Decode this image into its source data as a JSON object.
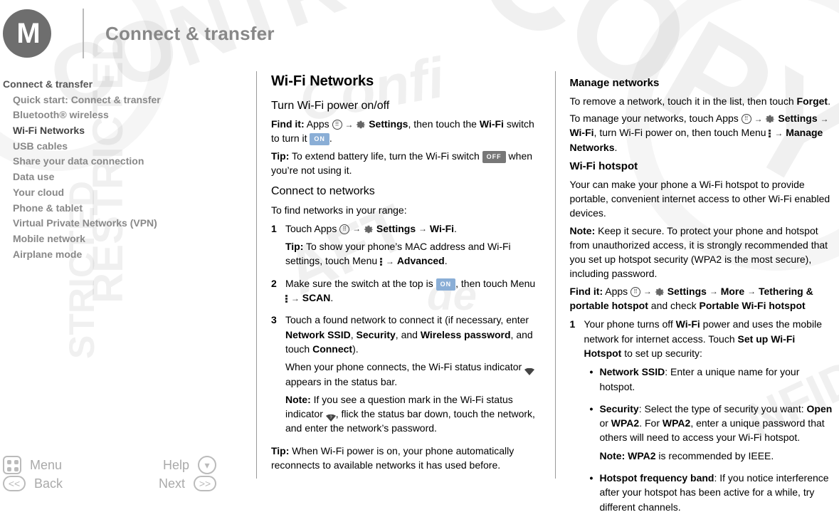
{
  "pageTitle": "Connect & transfer",
  "watermarks": {
    "w1": "CONTRO",
    "w2": "RESTRICTED",
    "w3": "COPY",
    "w4": "STRICTED",
    "w5": "Confi",
    "w6": "AFT",
    "w7": "de",
    "w8": "NFID"
  },
  "sidebar": {
    "root": "Connect & transfer",
    "items": [
      "Quick start: Connect & transfer",
      "Bluetooth® wireless",
      "Wi-Fi Networks",
      "USB cables",
      "Share your data connection",
      "Data use",
      "Your cloud",
      "Phone & tablet",
      "Virtual Private Networks (VPN)",
      "Mobile network",
      "Airplane mode"
    ],
    "nav": {
      "menu": "Menu",
      "help": "Help",
      "back": "Back",
      "next": "Next",
      "prev": "<<",
      "fwd": ">>"
    }
  },
  "switches": {
    "on": "ON",
    "off": "OFF"
  },
  "col1": {
    "h2": "Wi-Fi Networks",
    "sub1": "Turn Wi-Fi power on/off",
    "findIt1a": "Find it:",
    "findIt1b": "Apps",
    "findIt1c": "Settings",
    "findIt1d": ", then touch the ",
    "findIt1e": "Wi-Fi",
    "findIt1f": " switch to turn it ",
    "findIt1g": ".",
    "tip1a": "Tip:",
    "tip1b": " To extend battery life, turn the Wi-Fi switch ",
    "tip1c": " when you’re not using it.",
    "sub2": "Connect to networks",
    "p2": "To find networks in your range:",
    "li1a": "Touch Apps ",
    "li1b": "Settings",
    "li1c": "Wi-Fi",
    "li1d": ".",
    "li1tipA": "Tip:",
    "li1tipB": " To show your phone’s MAC address and Wi-Fi settings, touch Menu ",
    "li1tipC": "Advanced",
    "li1tipD": ".",
    "li2a": "Make sure the switch at the top is ",
    "li2b": ", then touch Menu ",
    "li2c": "SCAN",
    "li2d": ".",
    "li3a": "Touch a found network to connect it (if necessary, enter ",
    "li3b": "Network SSID",
    "li3c": ", ",
    "li3d": "Security",
    "li3e": ", and ",
    "li3f": "Wireless password",
    "li3g": ", and touch ",
    "li3h": "Connect",
    "li3i": ").",
    "li3p2a": "When your phone connects, the Wi-Fi status indicator ",
    "li3p2b": " appears in the status bar.",
    "li3noteA": "Note:",
    "li3noteB": " If you see a question mark in the Wi-Fi status indicator ",
    "li3noteC": ", flick the status bar down, touch the network, and enter the network’s password.",
    "tip2a": "Tip:",
    "tip2b": " When Wi-Fi power is on, your phone automatically reconnects to available networks it has used before."
  },
  "col2": {
    "h4a": "Manage networks",
    "p1a": "To remove a network, touch it in the list, then touch ",
    "p1b": "Forget",
    "p1c": ".",
    "p2a": "To manage your networks, touch Apps ",
    "p2b": "Settings",
    "p2c": "Wi-Fi",
    "p2d": ", turn Wi-Fi power on, then touch Menu ",
    "p2e": "Manage Networks",
    "p2f": ".",
    "h4b": "Wi-Fi hotspot",
    "p3": "Your can make your phone a Wi-Fi hotspot to provide portable, convenient internet access to other Wi-Fi enabled devices.",
    "noteA": "Note:",
    "noteB": " Keep it secure. To protect your phone and hotspot from unauthorized access, it is strongly recommended that you set up hotspot security (WPA2 is the most secure), including password.",
    "findItA": "Find it:",
    "findItB": " Apps ",
    "findItC": "Settings",
    "findItD": "More",
    "findItE": "Tethering & portable hotspot",
    "findItF": " and check ",
    "findItG": "Portable Wi-Fi hotspot",
    "li1a": "Your phone turns off ",
    "li1b": "Wi-Fi",
    "li1c": " power and uses the mobile network for internet access. Touch ",
    "li1d": "Set up Wi-Fi Hotspot",
    "li1e": " to set up security:",
    "b1a": "Network SSID",
    "b1b": ": Enter a unique name for your hotspot.",
    "b2a": "Security",
    "b2b": ": Select the type of security you want: ",
    "b2c": "Open",
    "b2d": " or ",
    "b2e": "WPA2",
    "b2f": ". For ",
    "b2g": "WPA2",
    "b2h": ", enter a unique password that others will need to access your Wi-Fi hotspot.",
    "b2noteA": "Note: WPA2",
    "b2noteB": " is recommended by IEEE.",
    "b3a": "Hotspot frequency band",
    "b3b": ": If you notice interference after your hotspot has been active for a while, try different channels."
  }
}
